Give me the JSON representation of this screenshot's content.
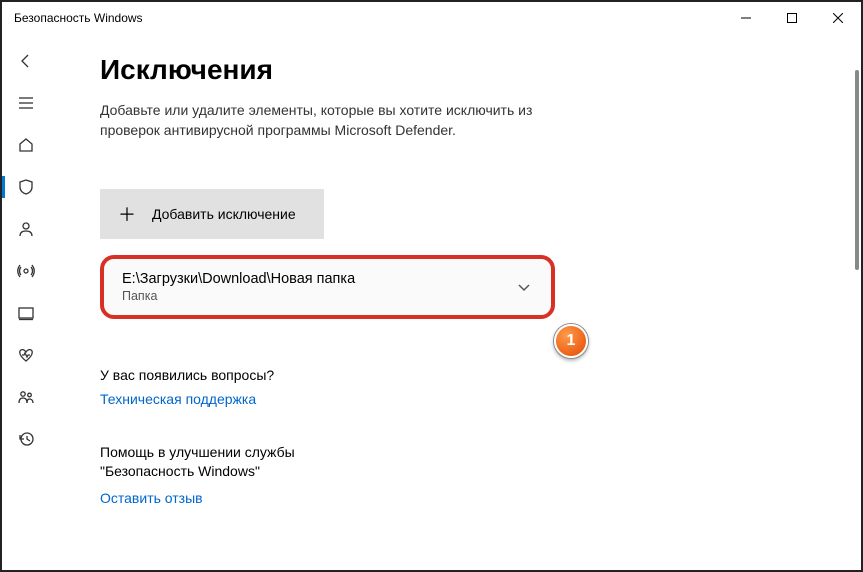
{
  "window": {
    "title": "Безопасность Windows"
  },
  "page": {
    "heading": "Исключения",
    "description": "Добавьте или удалите элементы, которые вы хотите исключить из проверок антивирусной программы Microsoft Defender."
  },
  "actions": {
    "add_label": "Добавить исключение"
  },
  "exclusions": [
    {
      "path": "E:\\Загрузки\\Download\\Новая папка",
      "kind": "Папка"
    }
  ],
  "callout": {
    "number": "1"
  },
  "questions": {
    "title": "У вас появились вопросы?",
    "link": "Техническая поддержка"
  },
  "help": {
    "title": "Помощь в улучшении службы \"Безопасность Windows\"",
    "link": "Оставить отзыв"
  }
}
